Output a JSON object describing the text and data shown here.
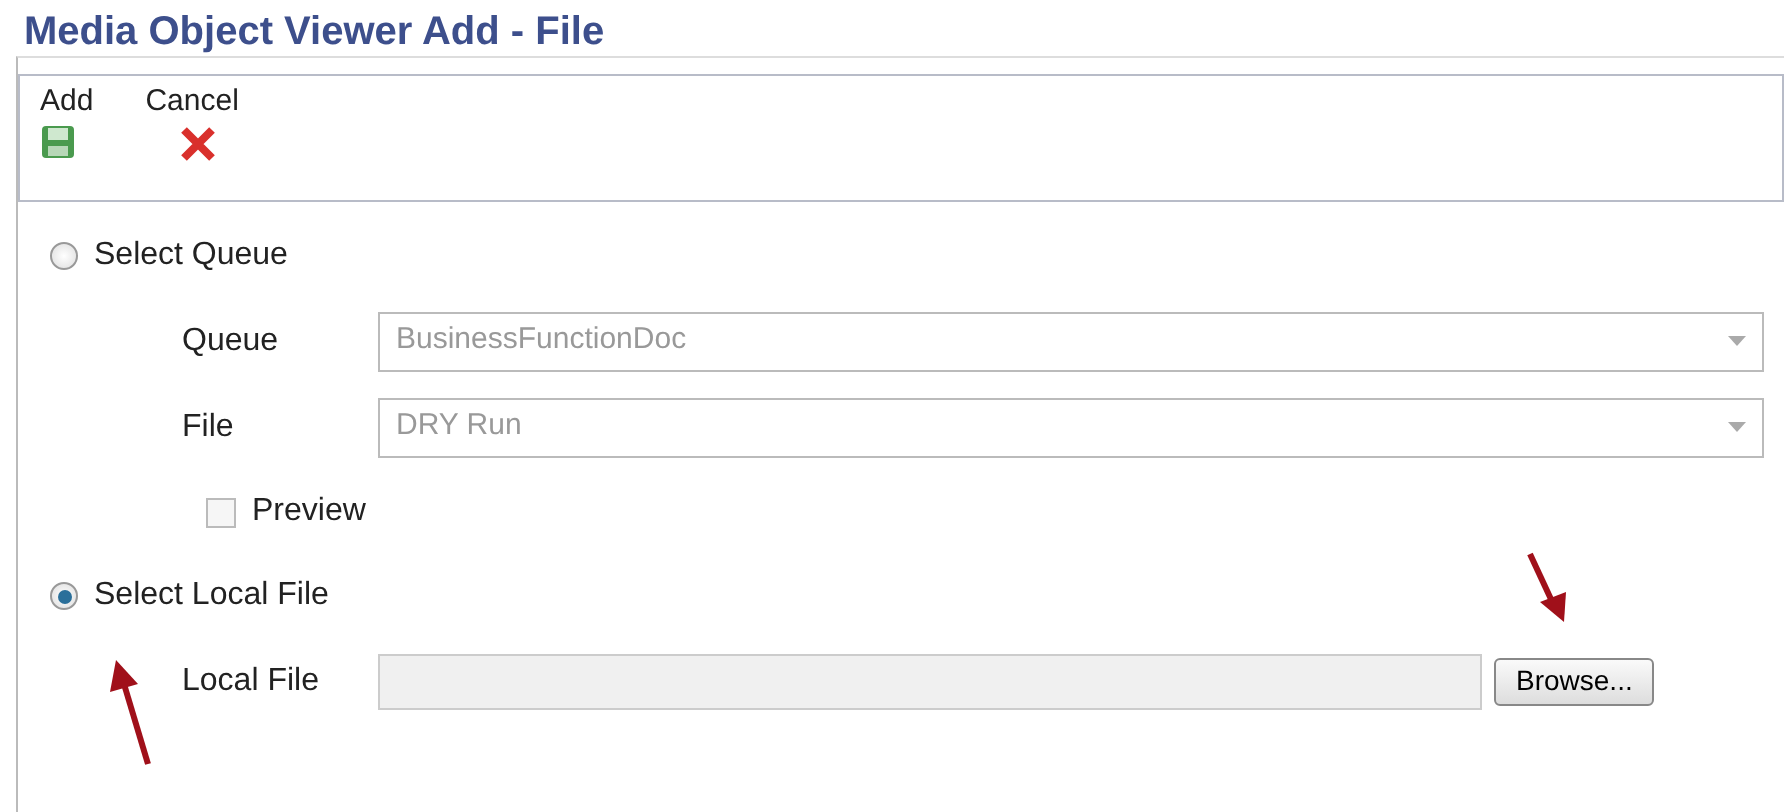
{
  "window": {
    "title": "Media Object Viewer Add - File"
  },
  "toolbar": [
    {
      "label": "Add",
      "kind": "save"
    },
    {
      "label": "Cancel",
      "kind": "cancel"
    }
  ],
  "options": [
    {
      "label": "Select Queue",
      "selected": false,
      "fields": [
        {
          "label": "Queue",
          "value": "BusinessFunctionDoc",
          "disabled": true
        },
        {
          "label": "File",
          "value": "DRY Run",
          "disabled": true
        }
      ],
      "preview": {
        "label": "Preview",
        "checked": false,
        "disabled": true
      }
    },
    {
      "label": "Select Local File",
      "selected": true,
      "local_file": {
        "label": "Local File",
        "button": "Browse..."
      }
    }
  ]
}
